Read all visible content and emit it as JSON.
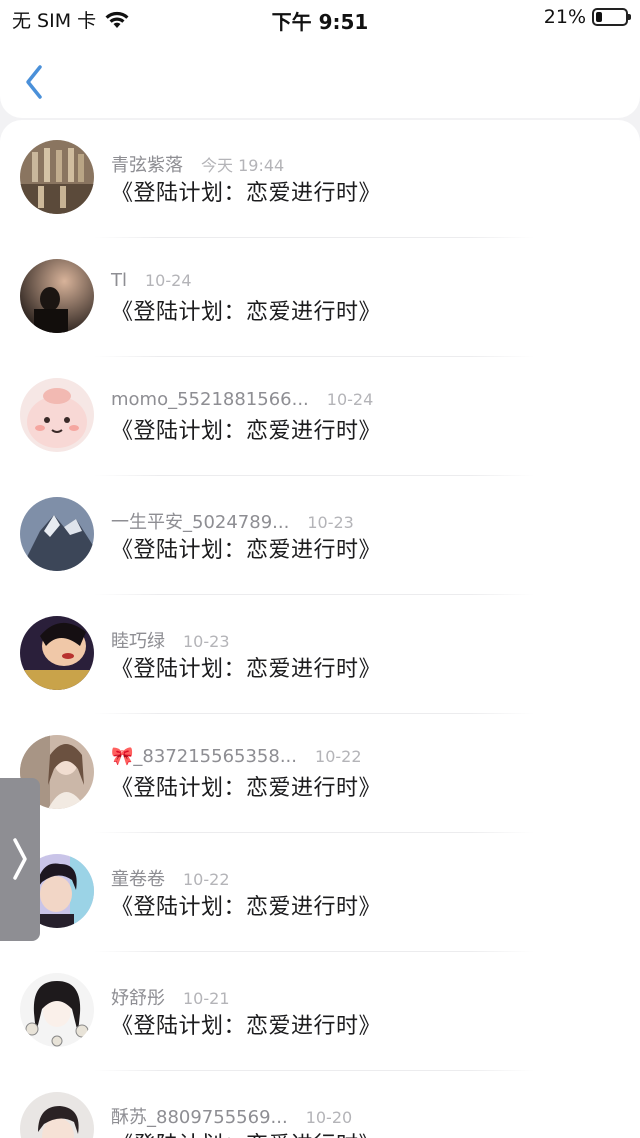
{
  "status_bar": {
    "carrier": "无 SIM 卡",
    "time": "下午 9:51",
    "battery_percent_text": "21%",
    "battery_level": 0.21,
    "wifi_icon": "wifi-icon"
  },
  "nav": {
    "back_icon": "chevron-left-icon",
    "accent_color": "#4a90d9"
  },
  "colors": {
    "username": "#8e8e93",
    "date": "#b4b4b8",
    "message": "#1c1c1e",
    "handle": "#8e8e93"
  },
  "comments": [
    {
      "username": "青弦紫落",
      "date": "今天 19:44",
      "message": "《登陆计划：恋爱进行时》"
    },
    {
      "username": "Tl",
      "date": "10-24",
      "message": "《登陆计划：恋爱进行时》"
    },
    {
      "username": "momo_5521881566...",
      "date": "10-24",
      "message": "《登陆计划：恋爱进行时》"
    },
    {
      "username": "一生平安_5024789...",
      "date": "10-23",
      "message": "《登陆计划：恋爱进行时》"
    },
    {
      "username": "睦巧绿",
      "date": "10-23",
      "message": "《登陆计划：恋爱进行时》"
    },
    {
      "username": "🎀_837215565358...",
      "date": "10-22",
      "message": "《登陆计划：恋爱进行时》"
    },
    {
      "username": "童卷卷",
      "date": "10-22",
      "message": "《登陆计划：恋爱进行时》"
    },
    {
      "username": "妤舒彤",
      "date": "10-21",
      "message": "《登陆计划：恋爱进行时》"
    },
    {
      "username": "酥苏_8809755569...",
      "date": "10-20",
      "message": "《登陆计划：恋爱进行时》"
    }
  ],
  "side_handle": {
    "icon": "chevron-right-icon"
  }
}
